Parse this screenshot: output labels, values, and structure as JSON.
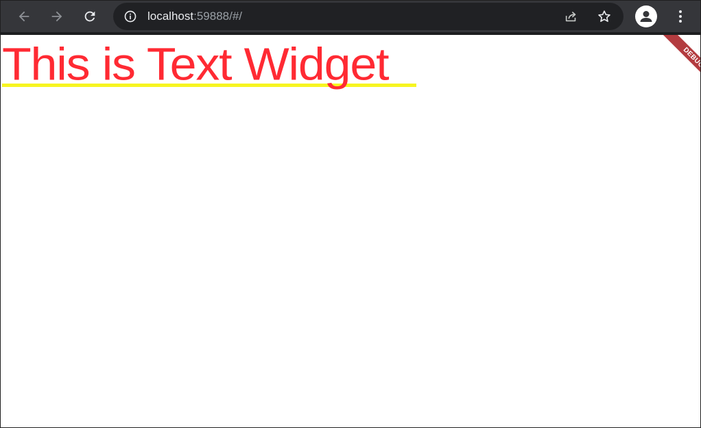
{
  "browser": {
    "back_icon": "arrow-left-icon",
    "forward_icon": "arrow-right-icon",
    "reload_icon": "reload-icon",
    "site_info_icon": "info-circle-icon",
    "url_host": "localhost",
    "url_rest": ":59888/#/",
    "share_icon": "share-icon",
    "bookmark_icon": "star-icon",
    "profile_icon": "person-icon",
    "menu_icon": "vertical-dots-icon",
    "toolbar_color": "#35363a",
    "omnibox_color": "#202124"
  },
  "page": {
    "headline": "This is Text Widget",
    "headline_color": "#ff2a33",
    "underline_color": "#f7f521",
    "debug_banner": "DEBUG",
    "debug_banner_color": "#b33b3f"
  }
}
